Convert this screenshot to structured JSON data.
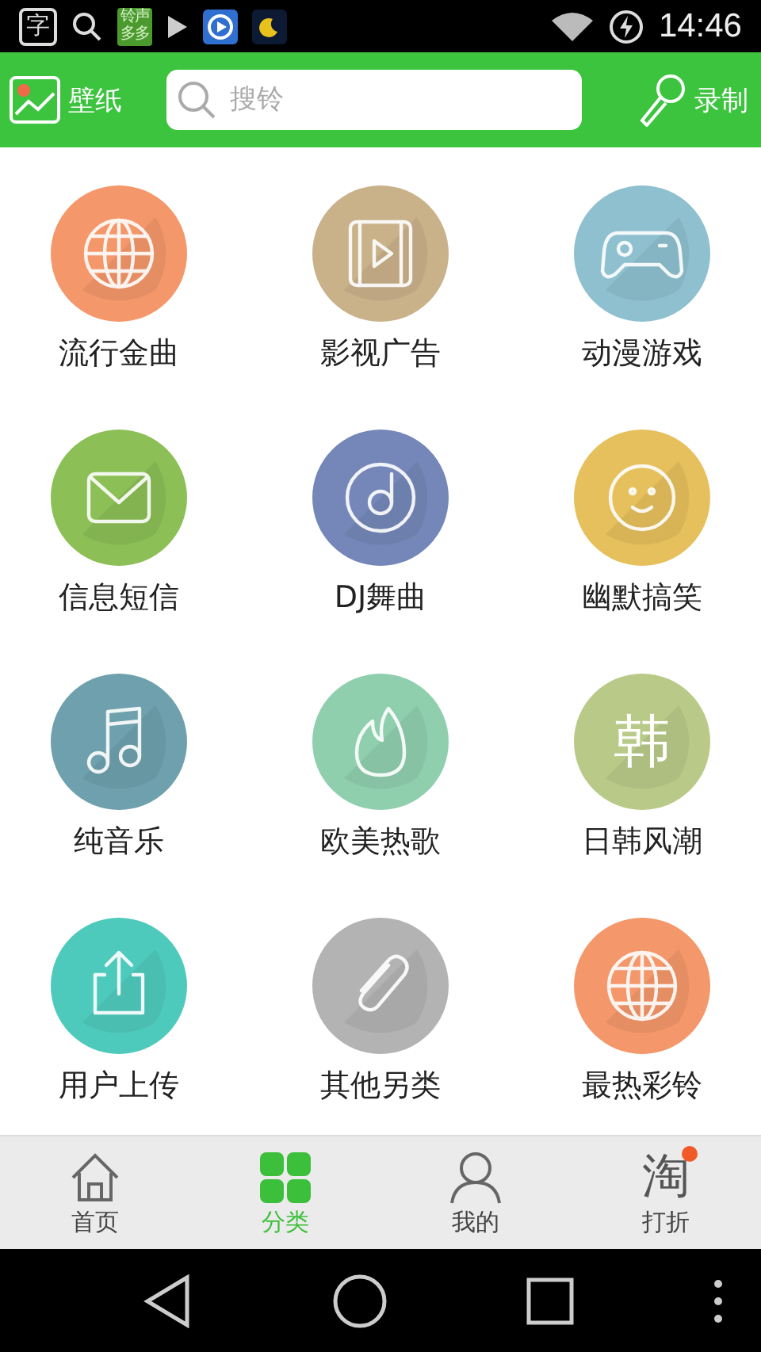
{
  "status_bar": {
    "notification_glyph": "字",
    "app_label": "铃声多多",
    "time": "14:46"
  },
  "header": {
    "wallpaper": "壁纸",
    "search": {
      "placeholder": "搜铃"
    },
    "record": "录制"
  },
  "categories": [
    {
      "label": "流行金曲",
      "color": "#f4976a"
    },
    {
      "label": "影视广告",
      "color": "#c9b18a"
    },
    {
      "label": "动漫游戏",
      "color": "#8ec0cf"
    },
    {
      "label": "信息短信",
      "color": "#8cbf55"
    },
    {
      "label": "DJ舞曲",
      "color": "#7487b8"
    },
    {
      "label": "幽默搞笑",
      "color": "#e6c05c"
    },
    {
      "label": "纯音乐",
      "color": "#6ea1ad"
    },
    {
      "label": "欧美热歌",
      "color": "#8fcfae"
    },
    {
      "label": "日韩风潮",
      "color": "#b9ca88"
    },
    {
      "label": "用户上传",
      "color": "#4ecabd"
    },
    {
      "label": "其他另类",
      "color": "#b3b3b3"
    },
    {
      "label": "最热彩铃",
      "color": "#f4976a"
    }
  ],
  "category_icon_glyph": "韩",
  "tabs": [
    {
      "label": "首页",
      "selected": false,
      "dot": false
    },
    {
      "label": "分类",
      "selected": true,
      "dot": false
    },
    {
      "label": "我的",
      "selected": false,
      "dot": false
    },
    {
      "label": "打折",
      "selected": false,
      "dot": true,
      "icon_text": "淘"
    }
  ]
}
